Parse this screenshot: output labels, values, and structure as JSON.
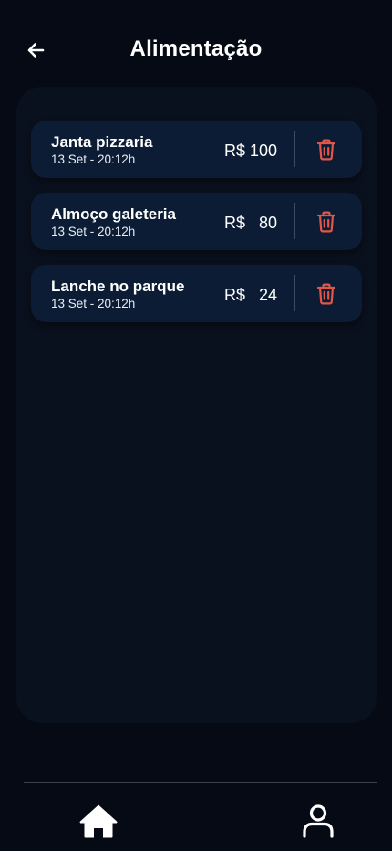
{
  "header": {
    "title": "Alimentação",
    "back_icon": "arrow-left-icon"
  },
  "expenses": [
    {
      "name": "Janta pizzaria",
      "date": "13 Set - 20:12h",
      "currency": "R$",
      "amount": "100"
    },
    {
      "name": "Almoço galeteria",
      "date": "13 Set - 20:12h",
      "currency": "R$",
      "amount": "80"
    },
    {
      "name": "Lanche no parque",
      "date": "13 Set - 20:12h",
      "currency": "R$",
      "amount": "24"
    }
  ],
  "bottom_nav": {
    "home_icon": "home-icon",
    "profile_icon": "user-icon"
  },
  "colors": {
    "background": "#050a14",
    "panel": "#0a111e",
    "card": "#0b1c34",
    "delete": "#e0574a",
    "text": "#ffffff"
  }
}
